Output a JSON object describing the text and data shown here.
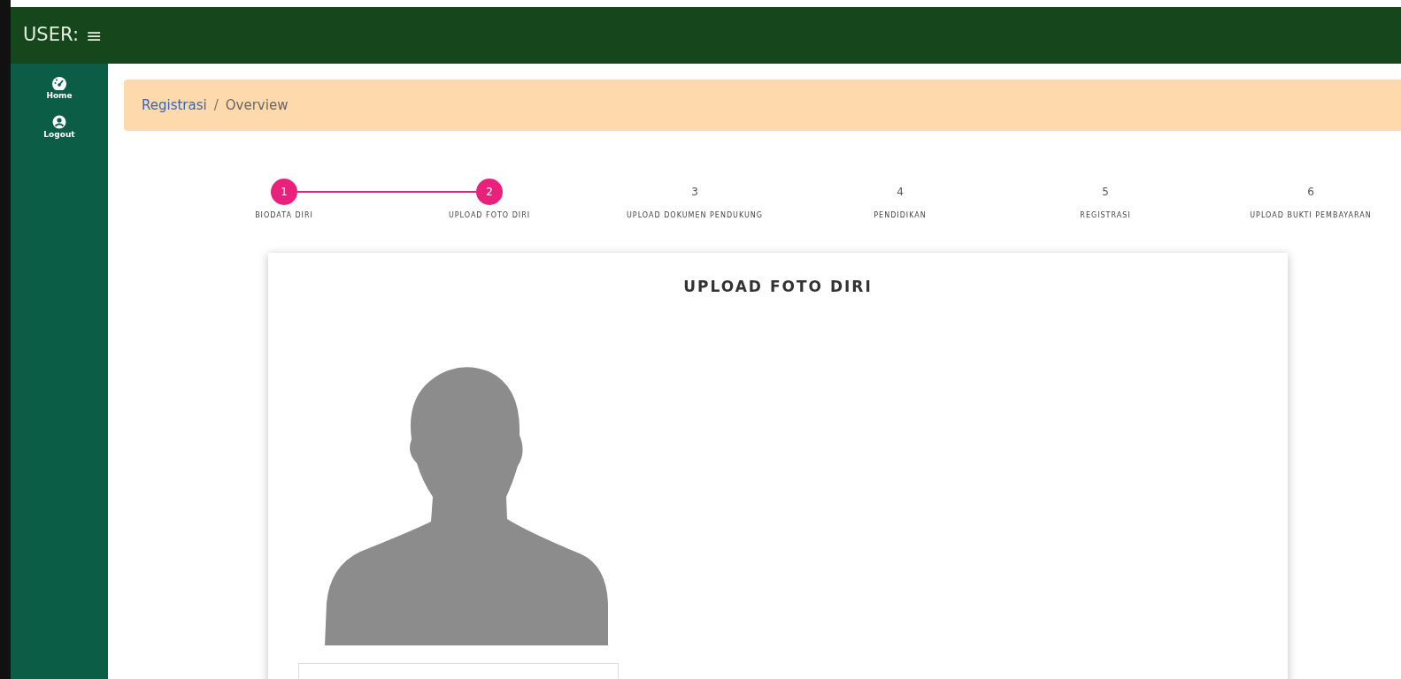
{
  "header": {
    "title": "USER:",
    "menu_glyph": "≡"
  },
  "sidebar": {
    "items": [
      {
        "label": "Home",
        "kind": "dashboard"
      },
      {
        "label": "Logout",
        "kind": "user"
      }
    ]
  },
  "breadcrumb": [
    {
      "label": "Registrasi",
      "link": true
    },
    {
      "separator": "/",
      "label": "Overview",
      "link": false
    }
  ],
  "steps": [
    {
      "number": "1",
      "label": "BIODATA DIRI",
      "done": true
    },
    {
      "number": "2",
      "label": "UPLOAD FOTO DIRI",
      "done": true
    },
    {
      "number": "3",
      "label": "UPLOAD DOKUMEN PENDUKUNG",
      "done": false
    },
    {
      "number": "4",
      "label": "PENDIDIKAN",
      "done": false
    },
    {
      "number": "5",
      "label": "REGISTRASI",
      "done": false
    },
    {
      "number": "6",
      "label": "UPLOAD BUKTI PEMBAYARAN",
      "done": false
    }
  ],
  "card": {
    "title": "UPLOAD FOTO DIRI"
  }
}
